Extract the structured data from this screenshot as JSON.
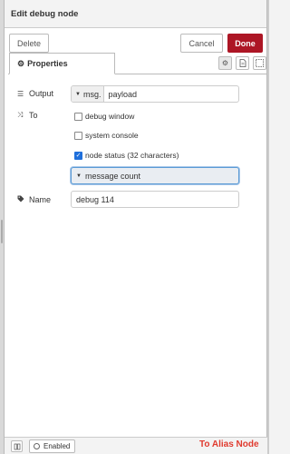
{
  "dialog": {
    "title": "Edit debug node"
  },
  "toolbar": {
    "delete_label": "Delete",
    "cancel_label": "Cancel",
    "done_label": "Done"
  },
  "tabs": {
    "properties_label": "Properties",
    "icons": [
      "gear-icon",
      "document-icon",
      "frame-icon"
    ]
  },
  "form": {
    "output_label": "Output",
    "output_type": "msg.",
    "output_value": "payload",
    "to_label": "To",
    "options": [
      {
        "label": "debug window",
        "checked": false
      },
      {
        "label": "system console",
        "checked": false
      },
      {
        "label": "node status (32 characters)",
        "checked": true
      }
    ],
    "status_select": "message count",
    "name_label": "Name",
    "name_value": "debug 114"
  },
  "footer": {
    "enabled_label": "Enabled"
  },
  "annotation": {
    "text": "To Alias Node",
    "color": "#e03a2e"
  },
  "colors": {
    "done_button": "#ad1625",
    "checkbox_checked": "#1f6fdb"
  }
}
